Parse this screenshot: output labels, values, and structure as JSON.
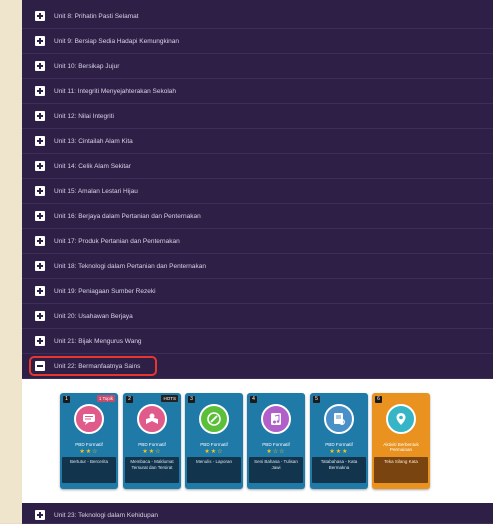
{
  "units": [
    {
      "id": "u8",
      "label": "Unit 8: Prihatin Pasti Selamat",
      "state": "collapsed"
    },
    {
      "id": "u9",
      "label": "Unit 9: Bersiap Sedia Hadapi Kemungkinan",
      "state": "collapsed"
    },
    {
      "id": "u10",
      "label": "Unit 10: Bersikap Jujur",
      "state": "collapsed"
    },
    {
      "id": "u11",
      "label": "Unit 11: Integriti Menyejahterakan Sekolah",
      "state": "collapsed"
    },
    {
      "id": "u12",
      "label": "Unit 12: Nilai Integriti",
      "state": "collapsed"
    },
    {
      "id": "u13",
      "label": "Unit 13: Cintailah Alam Kita",
      "state": "collapsed"
    },
    {
      "id": "u14",
      "label": "Unit 14: Celik Alam Sekitar",
      "state": "collapsed"
    },
    {
      "id": "u15",
      "label": "Unit 15: Amalan Lestari Hijau",
      "state": "collapsed"
    },
    {
      "id": "u16",
      "label": "Unit 16: Berjaya dalam Pertanian dan Penternakan",
      "state": "collapsed"
    },
    {
      "id": "u17",
      "label": "Unit 17: Produk Pertanian dan Penternakan",
      "state": "collapsed"
    },
    {
      "id": "u18",
      "label": "Unit 18: Teknologi dalam Pertanian dan Penternakan",
      "state": "collapsed"
    },
    {
      "id": "u19",
      "label": "Unit 19: Peniagaan Sumber Rezeki",
      "state": "collapsed"
    },
    {
      "id": "u20",
      "label": "Unit 20: Usahawan Berjaya",
      "state": "collapsed"
    },
    {
      "id": "u21",
      "label": "Unit 21: Bijak Mengurus Wang",
      "state": "collapsed"
    },
    {
      "id": "u22",
      "label": "Unit 22: Bermanfaatnya Sains",
      "state": "expanded"
    },
    {
      "id": "u23",
      "label": "Unit 23: Teknologi dalam Kehidupan",
      "state": "collapsed"
    }
  ],
  "cards": [
    {
      "num": "1",
      "tag": "1 Topik",
      "type": "PBD Formatif",
      "stars": "★★☆",
      "title": "Bertutur - Bercerita",
      "icon": "chat-icon",
      "color": "blue",
      "circle": "#e05a8a"
    },
    {
      "num": "2",
      "tag": "HOTS",
      "type": "PBD Formatif",
      "stars": "★★☆",
      "title": "Membaca - Maklumat Tersurat dan Tersirat",
      "icon": "reading-icon",
      "color": "blue",
      "circle": "#e05a8a"
    },
    {
      "num": "3",
      "tag": "",
      "type": "PBD Formatif",
      "stars": "★★☆",
      "title": "Menulis - Laporan",
      "icon": "pencil-icon",
      "color": "blue",
      "circle": "#5bbf3a"
    },
    {
      "num": "4",
      "tag": "",
      "type": "PBD Formatif",
      "stars": "★☆☆",
      "title": "Seni Bahasa - Tulisan Jawi",
      "icon": "music-icon",
      "color": "blue",
      "circle": "#b060c8"
    },
    {
      "num": "5",
      "tag": "",
      "type": "PBD Formatif",
      "stars": "★★★",
      "title": "Tatabahasa - Kata Bermakna",
      "icon": "document-search-icon",
      "color": "blue",
      "circle": "#4a90c8"
    },
    {
      "num": "6",
      "tag": "",
      "type": "Aktiviti Berbentuk Permainan",
      "stars": "",
      "title": "Teka Silang Kata",
      "icon": "location-icon",
      "color": "orange",
      "circle": "#36b5c6"
    }
  ]
}
